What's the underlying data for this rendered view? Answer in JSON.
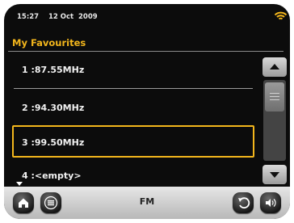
{
  "status": {
    "time": "15:27",
    "date": "12 Oct",
    "year": "2009",
    "wifi_icon": "wifi-signal-icon",
    "accent": "#f3b61c"
  },
  "screen": {
    "title": "My Favourites"
  },
  "favourites": [
    {
      "label": "1 :87.55MHz",
      "selected": false
    },
    {
      "label": "2 :94.30MHz",
      "selected": false
    },
    {
      "label": "3 :99.50MHz",
      "selected": true
    },
    {
      "label": "4 :<empty>",
      "selected": false
    }
  ],
  "toolbar": {
    "mode_label": "FM",
    "home_icon": "home-icon",
    "menu_icon": "menu-icon",
    "back_icon": "back-icon",
    "volume_icon": "volume-icon"
  }
}
